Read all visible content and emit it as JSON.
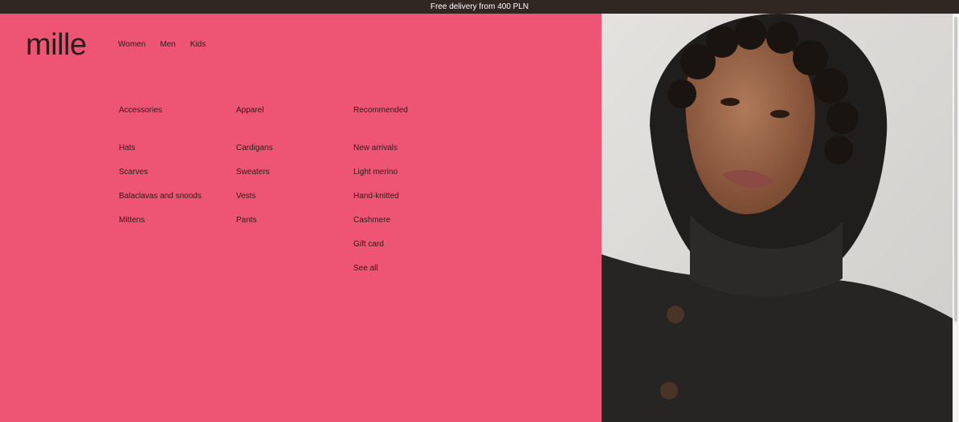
{
  "announcement": "Free delivery from 400 PLN",
  "logo": "mille",
  "nav": {
    "items": [
      "Women",
      "Men",
      "Kids"
    ]
  },
  "menu": {
    "accessories": {
      "heading": "Accessories",
      "items": [
        "Hats",
        "Scarves",
        "Balaclavas and snoods",
        "Mittens"
      ]
    },
    "apparel": {
      "heading": "Apparel",
      "items": [
        "Cardigans",
        "Sweaters",
        "Vests",
        "Pants"
      ]
    },
    "recommended": {
      "heading": "Recommended",
      "items": [
        "New arrivals",
        "Light merino",
        "Hand-knitted",
        "Cashmere",
        "Gift card",
        "See all"
      ]
    }
  },
  "colors": {
    "announcement_bg": "#302622",
    "menu_bg": "#ee5574",
    "text": "#2d1c1c"
  }
}
